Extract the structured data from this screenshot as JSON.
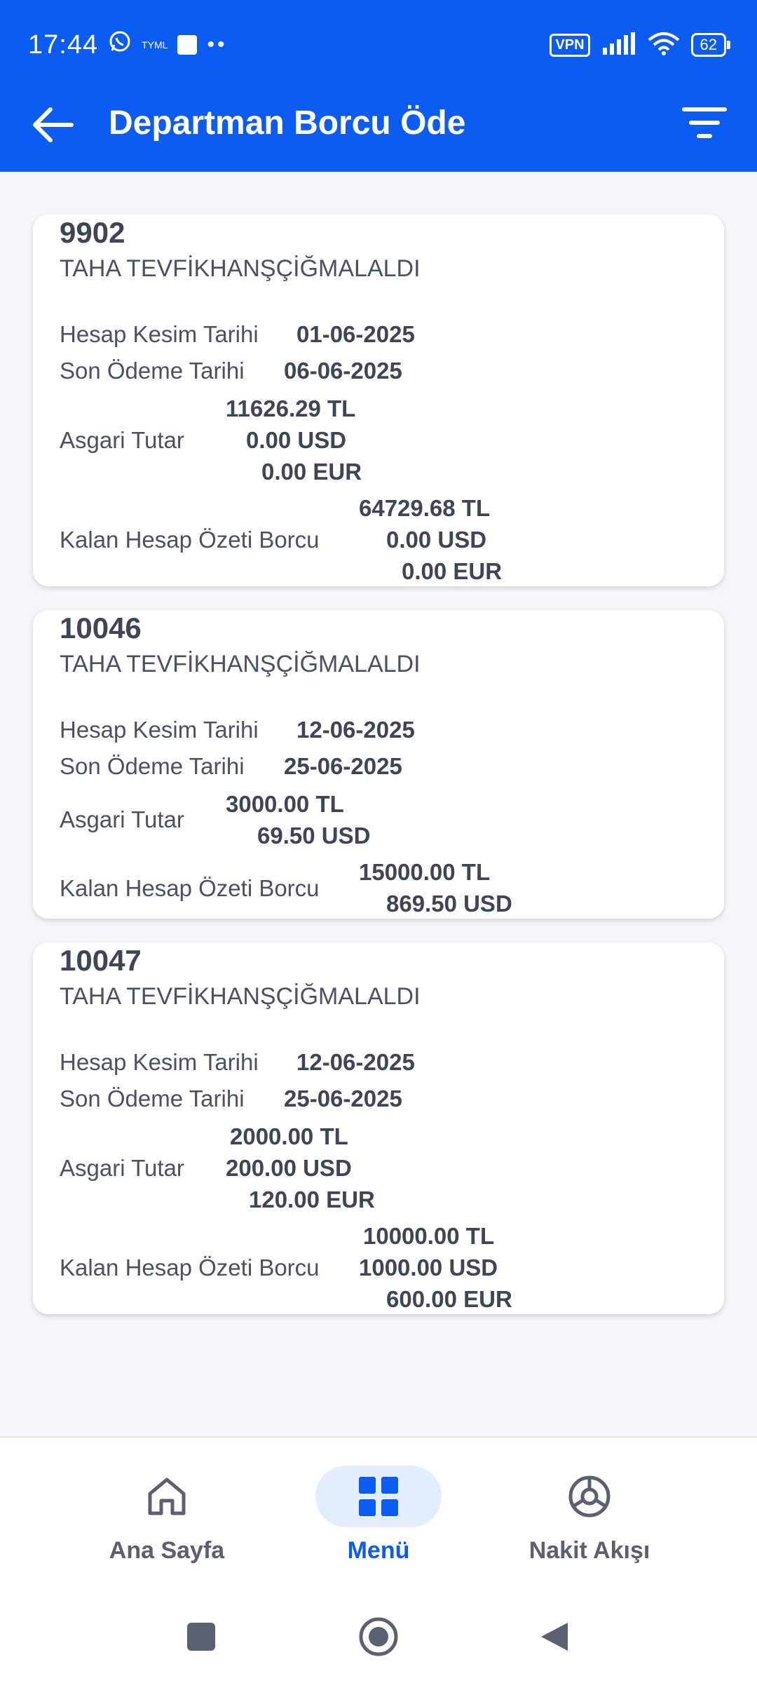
{
  "status_bar": {
    "time": "17:44",
    "carrier": "TYML",
    "vpn": "VPN",
    "battery": "62"
  },
  "header": {
    "title": "Departman Borcu Öde"
  },
  "labels": {
    "statement_date": "Hesap Kesim Tarihi",
    "due_date": "Son Ödeme Tarihi",
    "minimum": "Asgari Tutar",
    "remaining": "Kalan Hesap Özeti Borcu"
  },
  "cards": [
    {
      "id": "9902",
      "name": "TAHA TEVFİKHANŞÇİĞMALALDI",
      "statement_date": "01-06-2025",
      "due_date": "06-06-2025",
      "minimum": [
        "11626.29 TL",
        "0.00 USD",
        "0.00 EUR"
      ],
      "remaining": [
        "64729.68 TL",
        "0.00 USD",
        "0.00 EUR"
      ]
    },
    {
      "id": "10046",
      "name": "TAHA TEVFİKHANŞÇİĞMALALDI",
      "statement_date": "12-06-2025",
      "due_date": "25-06-2025",
      "minimum": [
        "3000.00 TL",
        "69.50 USD"
      ],
      "remaining": [
        "15000.00 TL",
        "869.50 USD"
      ]
    },
    {
      "id": "10047",
      "name": "TAHA TEVFİKHANŞÇİĞMALALDI",
      "statement_date": "12-06-2025",
      "due_date": "25-06-2025",
      "minimum": [
        "2000.00 TL",
        "200.00 USD",
        "120.00 EUR"
      ],
      "remaining": [
        "10000.00 TL",
        "1000.00 USD",
        "600.00 EUR"
      ]
    }
  ],
  "bottom_nav": [
    {
      "label": "Ana Sayfa",
      "icon": "home-icon"
    },
    {
      "label": "Menü",
      "icon": "grid-icon",
      "active": true
    },
    {
      "label": "Nakit Akışı",
      "icon": "cash-flow-icon"
    }
  ],
  "colors": {
    "primary": "#0d5cf2",
    "background": "#f5f6fa",
    "text": "#3d4556"
  }
}
